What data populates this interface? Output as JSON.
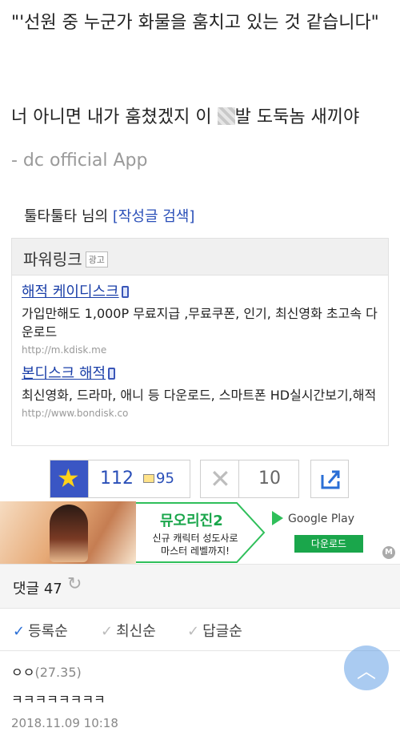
{
  "post": {
    "line1": "\"'선원 중 누군가 화물을 훔치고 있는 것 같습니다\"",
    "line2_before": "너 아니면 내가 훔쳤겠지 이 ",
    "line2_after": "발 도둑놈 새끼야",
    "signature": "- dc official App"
  },
  "author": {
    "prefix": "툴타툴타 님의 ",
    "search_link": "[작성글 검색]"
  },
  "powerlink": {
    "title": "파워링크",
    "ad_tag": "광고",
    "ads": [
      {
        "title": "해적 케이디스크",
        "desc": "가입만해도 1,000P 무료지급 ,무료쿠폰, 인기, 최신영화 초고속 다운로드",
        "url": "http://m.kdisk.me"
      },
      {
        "title": "본디스크 해적",
        "desc": "최신영화, 드라마, 애니 등 다운로드, 스마트폰 HD실시간보기,해적",
        "url": "http://www.bondisk.co"
      }
    ]
  },
  "votes": {
    "up": "112",
    "gold": "95",
    "down": "10"
  },
  "banner": {
    "title": "뮤오리진2",
    "subtitle": "신규 캐릭터 성도사로 마스터 레벨까지!",
    "store": "Google Play",
    "download": "다운로드",
    "badge": "M"
  },
  "comments": {
    "header": "댓글 47",
    "sort": [
      "등록순",
      "최신순",
      "답글순"
    ],
    "items": [
      {
        "author": "ㅇㅇ",
        "ip": "(27.35)",
        "body": "ㅋㅋㅋㅋㅋㅋㅋㅋ",
        "date": "2018.11.09 10:18"
      }
    ]
  },
  "icons": {
    "recommend": "star-icon",
    "not_recommend": "x-icon",
    "share": "share-icon",
    "refresh": "refresh-icon",
    "scroll_top": "chevron-up-icon"
  },
  "colors": {
    "link_blue": "#2a4fb8",
    "star_bg": "#3a56c4",
    "star": "#ffd21a",
    "check_blue": "#2a6fd6",
    "brand_green": "#1aa64b"
  }
}
